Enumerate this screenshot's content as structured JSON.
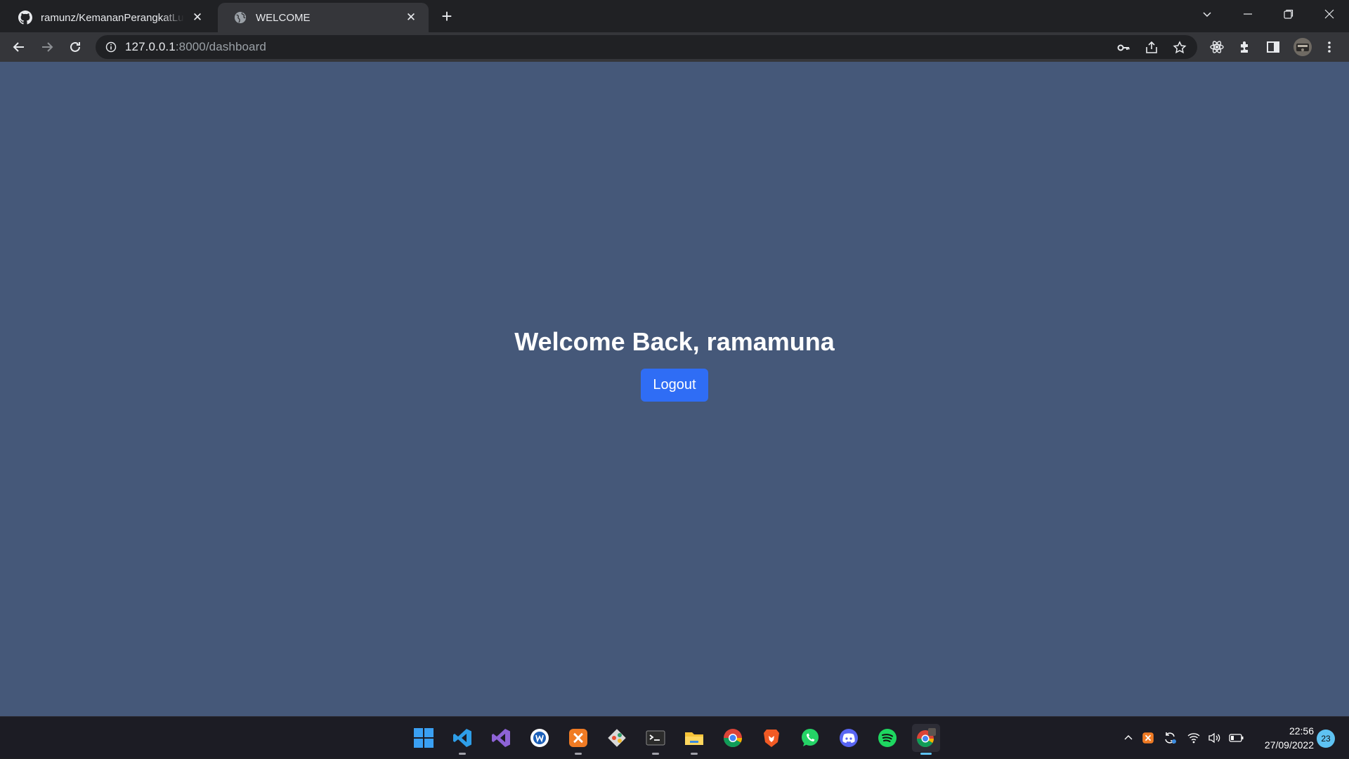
{
  "browser": {
    "tabs": [
      {
        "title": "ramunz/KemananPerangkatLunak",
        "icon": "github-icon",
        "active": false
      },
      {
        "title": "WELCOME",
        "icon": "globe-icon",
        "active": true
      }
    ],
    "address": {
      "host": "127.0.0.1",
      "rest": ":8000/dashboard"
    }
  },
  "page": {
    "heading": "Welcome Back, ramamuna",
    "logout_label": "Logout",
    "background": "#455879",
    "button_color": "#2f6df5"
  },
  "taskbar": {
    "apps": [
      "start-icon",
      "vscode-icon",
      "visual-studio-icon",
      "wps-icon",
      "xampp-icon",
      "git-icon",
      "terminal-icon",
      "file-explorer-icon",
      "chrome-icon",
      "brave-icon",
      "whatsapp-icon",
      "discord-icon",
      "spotify-icon",
      "chrome-profile-icon"
    ],
    "time": "22:56",
    "date": "27/09/2022",
    "notification_count": "23"
  }
}
